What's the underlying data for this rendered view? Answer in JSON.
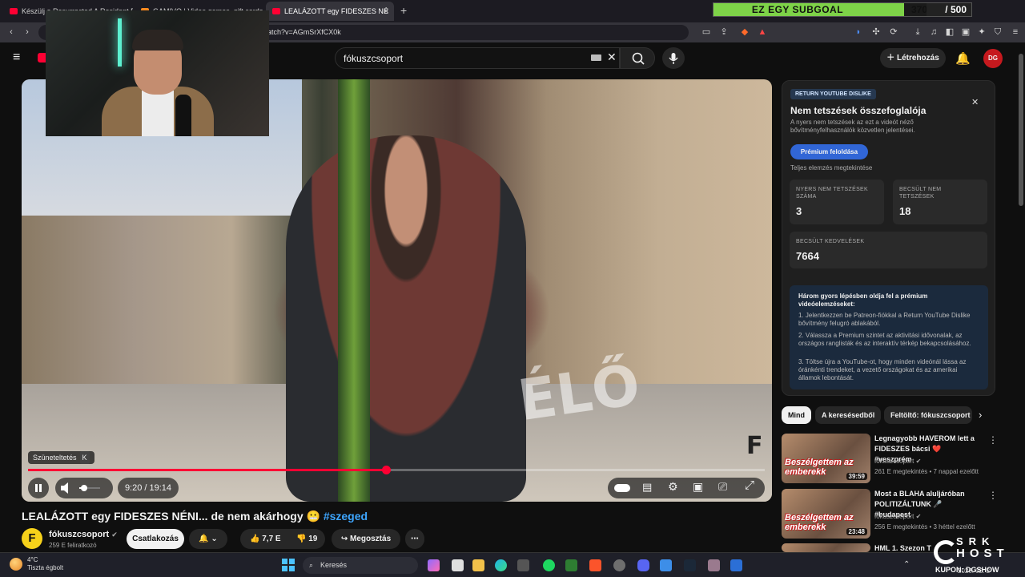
{
  "browser": {
    "tabs": [
      {
        "label": "Készülj a Resurrected A Resident Evil"
      },
      {
        "label": "GAMIVO | Video games, gift cards"
      },
      {
        "label": "LEALÁZOTT egy FIDESZES NÉ",
        "active": true
      }
    ],
    "url": "atch?v=AGmSrXfCX0k"
  },
  "subgoal": {
    "label": "EZ EGY SUBGOAL",
    "current": "370",
    "total": "/ 500",
    "progress": 0.74,
    "color": "#7ed348"
  },
  "header": {
    "search_value": "fókuszcsoport",
    "create_label": "Létrehozás",
    "avatar_text": "DG"
  },
  "player": {
    "pause_tooltip": "Szüneteltetés",
    "pause_key": "K",
    "time": "9:20 / 19:14",
    "progress": 0.4857,
    "watermark": "F",
    "scrawl": "ÉLŐ"
  },
  "video": {
    "title": "LEALÁZOTT egy FIDESZES NÉNI... de nem akárhogy 😬",
    "hashtag": "#szeged",
    "channel": "fókuszcsoport",
    "channel_initial": "F",
    "subscribers": "259 E feliratkozó",
    "join_label": "Csatlakozás",
    "likes": "7,7 E",
    "dislikes": "19",
    "share_label": "Megosztás"
  },
  "ryd": {
    "badge": "RETURN YOUTUBE DISLIKE",
    "title": "Nem tetszések összefoglalója",
    "description": "A nyers nem tetszések az ezt a videót néző bővítményfelhasználók közvetlen jelentései.",
    "premium_button": "Prémium feloldása",
    "full_analysis": "Teljes elemzés megtekintése",
    "stats": [
      {
        "label": "NYERS NEM TETSZÉSEK SZÁMA",
        "value": "3"
      },
      {
        "label": "BECSÜLT NEM TETSZÉSEK",
        "value": "18"
      },
      {
        "label": "BECSÜLT KEDVELÉSEK",
        "value": "7664"
      }
    ],
    "steps_heading": "Három gyors lépésben oldja fel a prémium videóelemzéseket:",
    "steps": [
      "1.  Jelentkezzen be Patreon-fiókkal a Return YouTube Dislike bővítmény felugró ablakából.",
      "2.  Válassza a Premium szintet az aktivitási idővonalak, az országos ranglisták és az interaktív térkép bekapcsolásához.",
      "3.  Töltse újra a YouTube-ot, hogy minden videónál lássa az óránkénti trendeket, a vezető országokat és az amerikai államok lebontását."
    ]
  },
  "chips": [
    "Mind",
    "A keresésedből",
    "Feltöltő: fókuszcsoport"
  ],
  "recommendations": [
    {
      "title": "Legnagyobb HAVEROM lett a FIDESZES bácsi ❤️ #veszprém",
      "channel": "fókuszcsoport",
      "meta": "261 E megtekintés • 7 nappal ezelőtt",
      "duration": "39:59",
      "thumb_text": "Beszélgettem az emberekk"
    },
    {
      "title": "Most a BLAHA aluljáróban POLITIZÁLTUNK 🎤 #budapest",
      "channel": "fókuszcsoport",
      "meta": "256 E megtekintés • 3 héttel ezelőtt",
      "duration": "23:48",
      "thumb_text": "Beszélgettem az emberekk"
    },
    {
      "title": "HML 1. Szezon T",
      "channel": "",
      "meta": "",
      "duration": "",
      "thumb_text": ""
    }
  ],
  "taskbar": {
    "weather_temp": "4°C",
    "weather_desc": "Tiszta égbolt",
    "search_label": "Keresés",
    "clock": "2026. 02. 2"
  },
  "watermark": {
    "line1": "SRK",
    "line2": "HOST",
    "line3": "KUPON: DGSHOW"
  }
}
